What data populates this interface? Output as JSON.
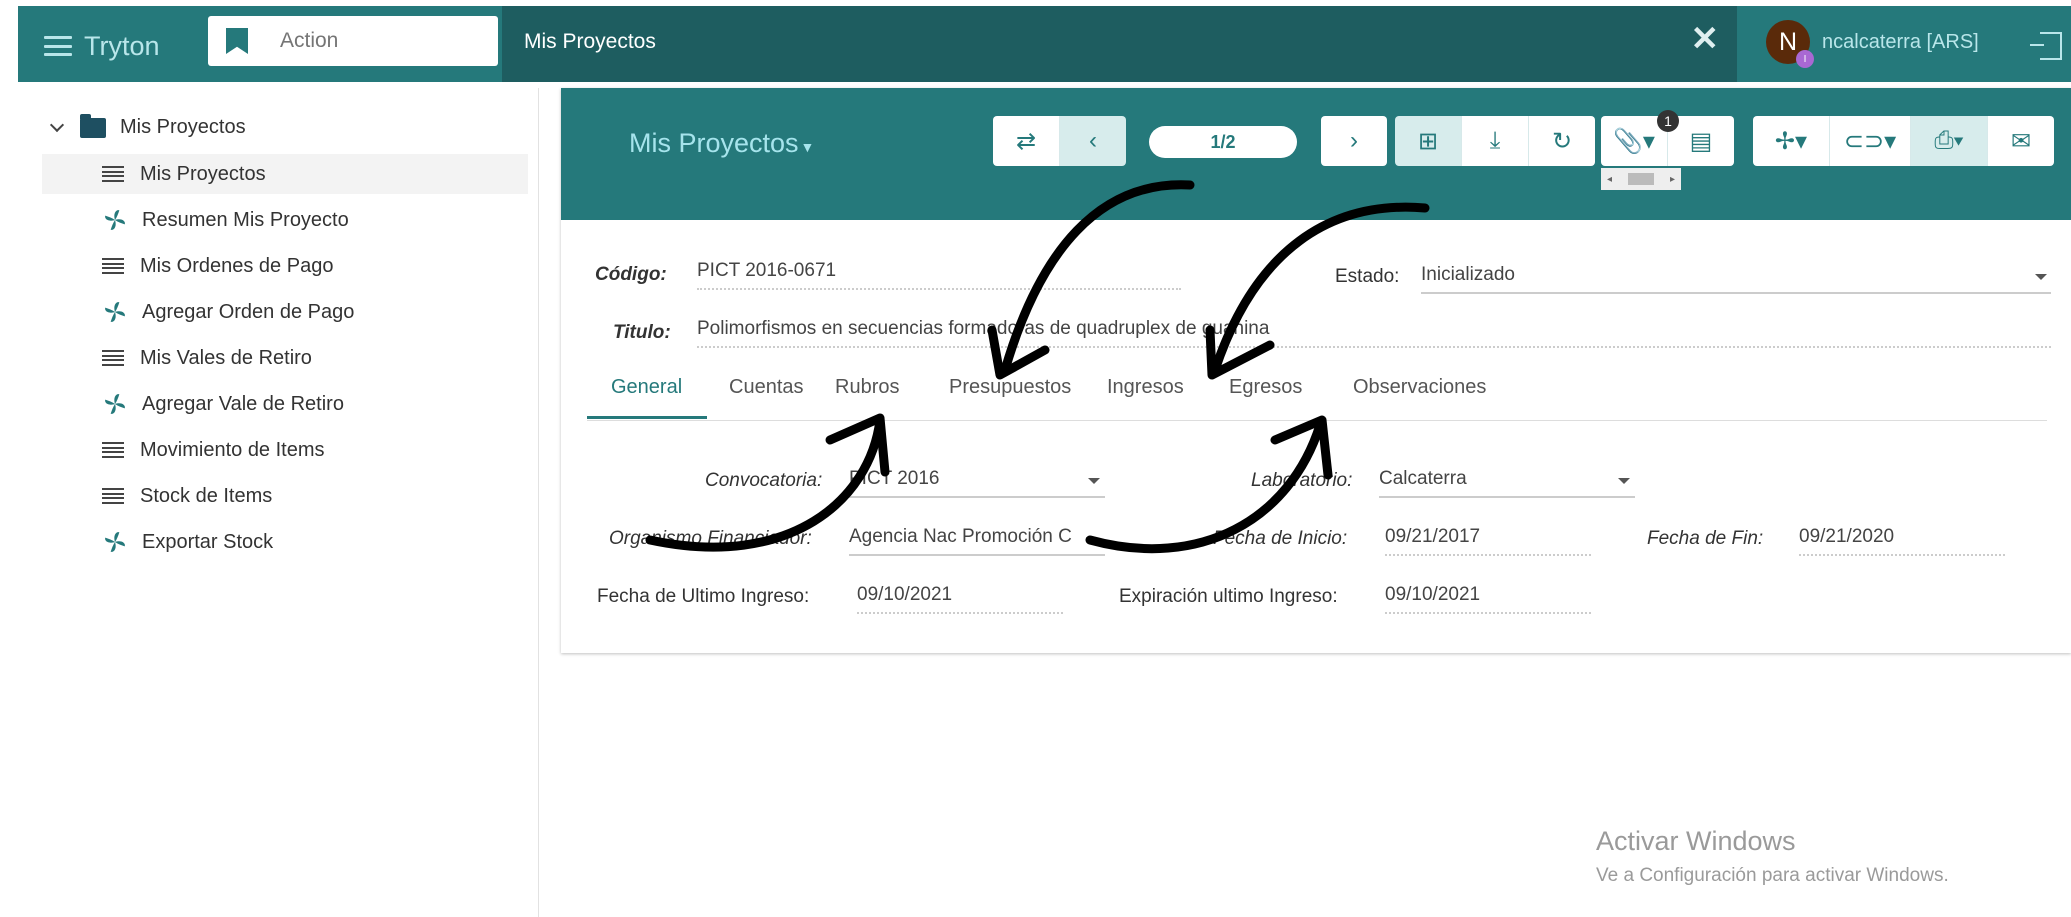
{
  "topbar": {
    "brand": "Tryton",
    "action_placeholder": "Action",
    "tab_title": "Mis Proyectos",
    "user_initial": "N",
    "user_badge": "I",
    "user_name": "ncalcaterra [ARS]"
  },
  "sidebar": {
    "root_label": "Mis Proyectos",
    "items": [
      {
        "label": "Mis Proyectos",
        "icon": "list-icon"
      },
      {
        "label": "Resumen Mis Proyecto",
        "icon": "wizard-icon"
      },
      {
        "label": "Mis Ordenes de Pago",
        "icon": "list-icon"
      },
      {
        "label": "Agregar Orden de Pago",
        "icon": "wizard-icon"
      },
      {
        "label": "Mis Vales de Retiro",
        "icon": "list-icon"
      },
      {
        "label": "Agregar Vale de Retiro",
        "icon": "wizard-icon"
      },
      {
        "label": "Movimiento de Items",
        "icon": "list-icon"
      },
      {
        "label": "Stock de Items",
        "icon": "list-icon"
      },
      {
        "label": "Exportar Stock",
        "icon": "wizard-icon"
      }
    ]
  },
  "form": {
    "title": "Mis Proyectos",
    "record_position": "1/2",
    "attachment_count": "1",
    "codigo_label": "Código:",
    "codigo_value": "PICT 2016-0671",
    "estado_label": "Estado:",
    "estado_value": "Inicializado",
    "titulo_label": "Titulo:",
    "titulo_value": "Polimorfismos en secuencias formadoras de quadruplex de guanina",
    "tabs": [
      "General",
      "Cuentas",
      "Rubros",
      "Presupuestos",
      "Ingresos",
      "Egresos",
      "Observaciones"
    ],
    "fields": {
      "convocatoria_label": "Convocatoria:",
      "convocatoria_value": "PICT 2016",
      "laboratorio_label": "Laboratorio:",
      "laboratorio_value": "Calcaterra",
      "organismo_label": "Organismo Financiador:",
      "organismo_value": "Agencia Nac Promoción C",
      "fecha_inicio_label": "Fecha de Inicio:",
      "fecha_inicio_value": "09/21/2017",
      "fecha_fin_label": "Fecha de Fin:",
      "fecha_fin_value": "09/21/2020",
      "ultimo_ingreso_label": "Fecha de Ultimo Ingreso:",
      "ultimo_ingreso_value": "09/10/2021",
      "expiracion_label": "Expiración ultimo Ingreso:",
      "expiracion_value": "09/10/2021"
    }
  },
  "watermark": {
    "line1": "Activar Windows",
    "line2": "Ve a Configuración para activar Windows."
  },
  "colors": {
    "primary": "#25797b",
    "primary_dark": "#1e5d60",
    "accent_text": "#a6e4ec"
  }
}
